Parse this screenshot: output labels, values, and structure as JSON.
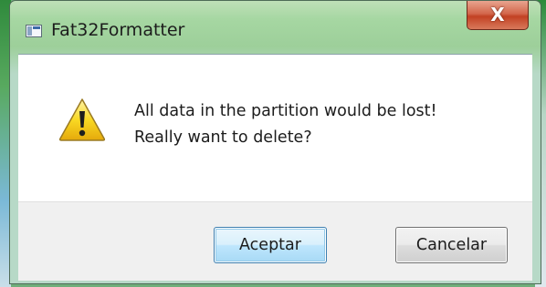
{
  "window": {
    "title": "Fat32Formatter",
    "icon": "app-window-icon",
    "close_icon": "close-icon",
    "close_glyph": "X"
  },
  "dialog": {
    "icon": "warning-icon",
    "message_lines": [
      "All data in the partition would be lost!",
      "Really want to delete?"
    ]
  },
  "buttons": {
    "ok_label": "Aceptar",
    "cancel_label": "Cancelar"
  },
  "colors": {
    "close_button": "#c94526",
    "default_button_border": "#3c7fb1",
    "warning_fill": "#f7d21a"
  }
}
